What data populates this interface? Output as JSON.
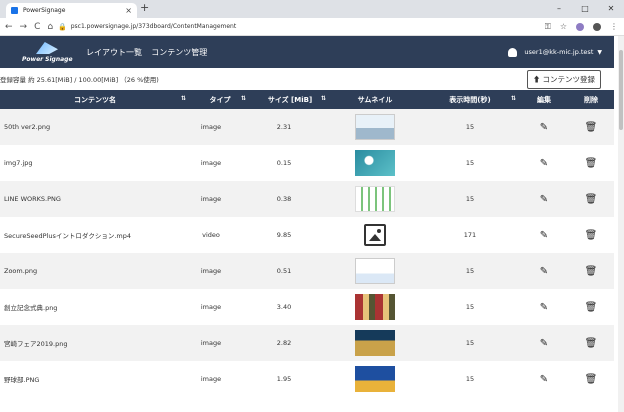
{
  "browser": {
    "tab_title": "PowerSignage",
    "tab_close": "×",
    "new_tab": "+",
    "url": "psc1.powersignage.jp/373dboard/ContentManagement",
    "back": "←",
    "forward": "→",
    "reload": "C",
    "home": "⌂",
    "lock": "🔒",
    "key": "⚿",
    "star": "☆",
    "menu": "⋮",
    "minimize": "–",
    "maximize": "□",
    "close": "✕"
  },
  "appbar": {
    "logo_text": "Power Signage",
    "menu": [
      {
        "label": "レイアウト一覧"
      },
      {
        "label": "コンテンツ管理"
      }
    ],
    "user": "user1@kk-mic.jp.test",
    "caret": "▼"
  },
  "storage": {
    "label": "登録容量 約 25.61[MiB] / 100.00[MiB] （26 %使用)",
    "register_button": "コンテンツ登録",
    "register_icon": "⬆"
  },
  "table": {
    "headers": {
      "name": "コンテンツ名",
      "type": "タイプ",
      "size": "サイズ [MiB]",
      "thumb": "サムネイル",
      "duration": "表示時間(秒)",
      "edit": "編集",
      "delete": "削除"
    },
    "sort_icon": "⇅",
    "edit_icon": "✎",
    "delete_icon": "🗑",
    "rows": [
      {
        "name": "50th ver2.png",
        "type": "image",
        "size": "2.31",
        "duration": "15",
        "thumb": "photo-light"
      },
      {
        "name": "img7.jpg",
        "type": "image",
        "size": "0.15",
        "duration": "15",
        "thumb": "photo-teal"
      },
      {
        "name": "LINE WORKS.PNG",
        "type": "image",
        "size": "0.38",
        "duration": "15",
        "thumb": "diagram-green"
      },
      {
        "name": "SecureSeedPlusイントロダクション.mp4",
        "type": "video",
        "size": "9.85",
        "duration": "171",
        "thumb": "placeholder"
      },
      {
        "name": "Zoom.png",
        "type": "image",
        "size": "0.51",
        "duration": "15",
        "thumb": "doc-blue"
      },
      {
        "name": "創立記念式典.png",
        "type": "image",
        "size": "3.40",
        "duration": "15",
        "thumb": "collage-red"
      },
      {
        "name": "宮崎フェア2019.png",
        "type": "image",
        "size": "2.82",
        "duration": "15",
        "thumb": "poster-dark"
      },
      {
        "name": "野球部.PNG",
        "type": "image",
        "size": "1.95",
        "duration": "15",
        "thumb": "poster-blue"
      }
    ]
  },
  "colors": {
    "header_bg": "#2e3e58",
    "row_alt": "#f2f2f2",
    "user_link": "#ffffff"
  }
}
